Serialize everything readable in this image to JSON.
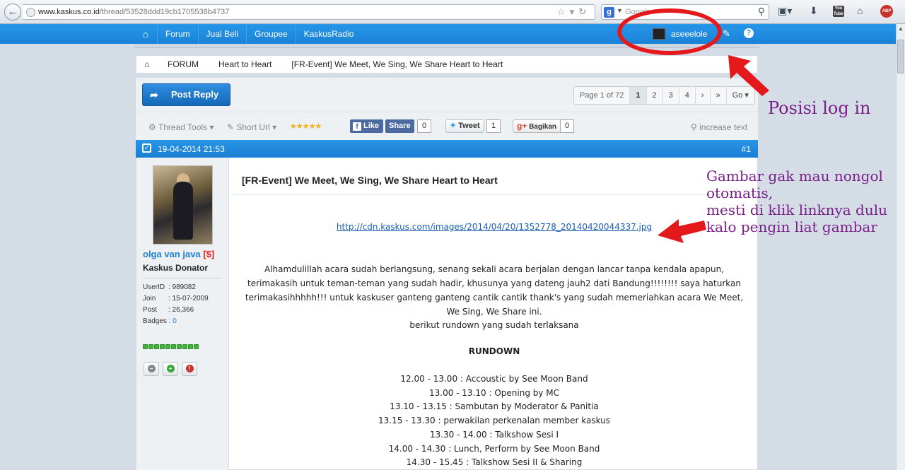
{
  "browser": {
    "url_host": "www.kaskus.co.id",
    "url_path": "/thread/53528ddd19cb1705538b4737",
    "search_placeholder": "Google",
    "youtube_label": "You Tube",
    "abp_label": "ABP"
  },
  "nav": {
    "items": [
      {
        "label": "Forum"
      },
      {
        "label": "Jual Beli"
      },
      {
        "label": "Groupee"
      },
      {
        "label": "KaskusRadio"
      }
    ],
    "username": "aseeelole"
  },
  "breadcrumb": {
    "items": [
      {
        "label": "FORUM"
      },
      {
        "label": "Heart to Heart"
      },
      {
        "label": "[FR-Event] We Meet, We Sing, We Share Heart to Heart"
      }
    ]
  },
  "toolbar": {
    "post_reply_label": "Post Reply",
    "page_info": "Page 1 of 72",
    "pages": [
      "1",
      "2",
      "3",
      "4"
    ],
    "go_label": "Go",
    "thread_tools_label": "Thread Tools",
    "short_url_label": "Short Url",
    "rating_stars": 5,
    "fb_like_label": "Like",
    "fb_share_label": "Share",
    "fb_count": "0",
    "tweet_label": "Tweet",
    "tweet_count": "1",
    "gplus_label": "Bagikan",
    "gplus_count": "0",
    "increase_text_label": "increase text"
  },
  "post": {
    "date": "19-04-2014 21:53",
    "number": "#1",
    "title": "[FR-Event] We Meet, We Sing, We Share Heart to Heart",
    "image_link": "http://cdn.kaskus.com/images/2014/04/20/1352778_20140420044337.jpg",
    "paragraph": "Alhamdulillah acara sudah berlangsung, senang sekali acara berjalan dengan lancar tanpa kendala apapun, terimakasih untuk teman-teman yang sudah hadir, khusunya yang dateng jauh2 dati Bandung!!!!!!!! saya haturkan terimakasihhhhh!!! untuk kaskuser ganteng ganteng cantik cantik thank's yang sudah memeriahkan acara We Meet, We Sing, We Share ini.",
    "paragraph2": "berikut rundown yang sudah terlaksana",
    "rundown_title": "RUNDOWN",
    "rundown": [
      "12.00 - 13.00 : Accoustic by See Moon Band",
      "13.00 - 13.10 : Opening by MC",
      "13.10 - 13.15 : Sambutan by Moderator & Panitia",
      "13.15 - 13.30 : perwakilan perkenalan member kaskus",
      "13.30 - 14.00 : Talkshow Sesi I",
      "14.00 - 14.30 : Lunch, Perform by See Moon Band",
      "14.30 - 15.45 : Talkshow Sesi II & Sharing"
    ]
  },
  "user": {
    "name": "olga van java",
    "donor_tag": "[$]",
    "rank": "Kaskus Donator",
    "userid_label": "UserID",
    "userid": ": 989082",
    "join_label": "Join",
    "join": ": 15-07-2009",
    "post_label": "Post",
    "post": ": 26,366",
    "badges_label": "Badges",
    "badges": ": 0",
    "reputation_level": 10
  },
  "annotations": {
    "login_note": "Posisi log in",
    "image_note": [
      "Gambar gak mau nongol",
      "otomatis,",
      "mesti di klik linknya dulu",
      "kalo pengin liat gambar"
    ],
    "circle_color": "#e4191c",
    "text_color": "#7a1f8a"
  },
  "colors": {
    "nav_blue": "#1d8be0",
    "link_blue": "#1e7ed1",
    "donor_red": "#e02020"
  }
}
